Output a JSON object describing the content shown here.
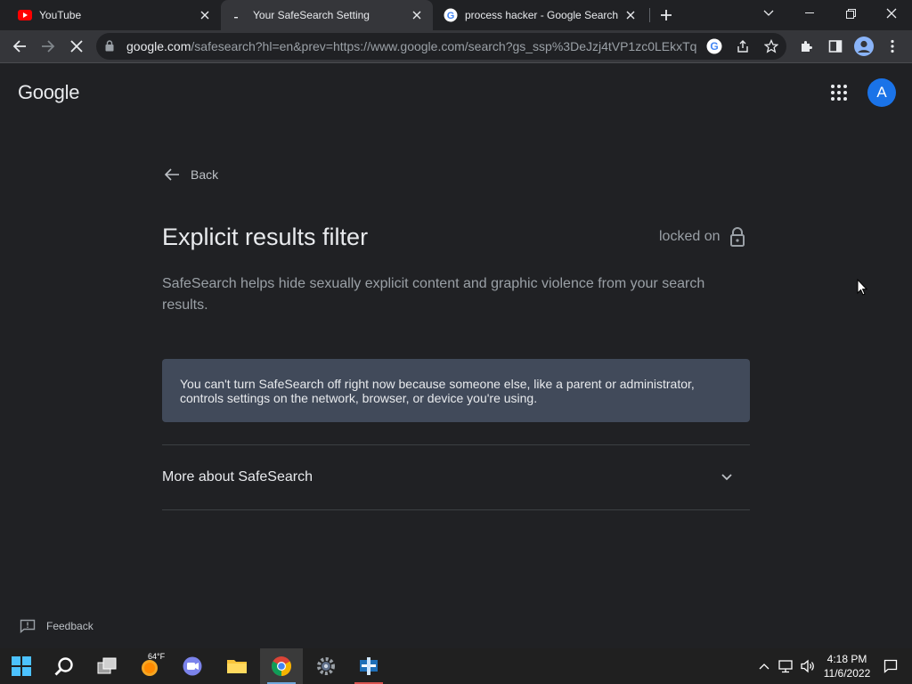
{
  "browser": {
    "tabs": [
      {
        "title": "YouTube",
        "favicon": "youtube-icon"
      },
      {
        "title": "Your SafeSearch Setting",
        "favicon": "loading-icon",
        "active": true
      },
      {
        "title": "process hacker - Google Search",
        "favicon": "google-g-icon"
      }
    ],
    "url_host": "google.com",
    "url_path": "/safesearch?hl=en&prev=https://www.google.com/search?gs_ssp%3DeJzj4tVP1zc0LEkxTq..."
  },
  "page": {
    "logo": "Google",
    "avatar_letter": "A",
    "back_label": "Back",
    "heading": "Explicit results filter",
    "lock_status": "locked on",
    "description": "SafeSearch helps hide sexually explicit content and graphic violence from your search results.",
    "notice": "You can't turn SafeSearch off right now because someone else, like a parent or administrator, controls settings on the network, browser, or device you're using.",
    "more_label": "More about SafeSearch",
    "feedback_label": "Feedback"
  },
  "taskbar": {
    "weather": "64°F",
    "time": "4:18 PM",
    "date": "11/6/2022"
  },
  "colors": {
    "page_bg": "#202124",
    "notice_bg": "#414a5a",
    "avatar_bg": "#1a73e8",
    "text_primary": "#e8eaed",
    "text_secondary": "#9aa0a6"
  }
}
